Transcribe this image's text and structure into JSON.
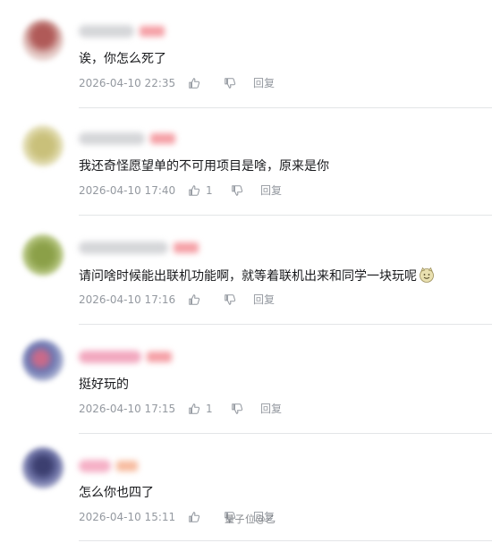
{
  "comments": [
    {
      "text": "诶，你怎么死了",
      "time": "2026-04-10 22:35",
      "likes": "",
      "reply": "回复",
      "avatar_color": "#d8b9b5",
      "name_color": "#d9d9dc",
      "level_color": "#f6a3a8"
    },
    {
      "text": "我还奇怪愿望单的不可用项目是啥，原来是你",
      "time": "2026-04-10 17:40",
      "likes": "1",
      "reply": "回复",
      "avatar_color": "#d6cf9e",
      "name_color": "#d9d9dc",
      "level_color": "#f6a3a8"
    },
    {
      "text": "请问啥时候能出联机功能啊，就等着联机出来和同学一块玩呢",
      "time": "2026-04-10 17:16",
      "likes": "",
      "reply": "回复",
      "avatar_color": "#a3b86a",
      "name_color": "#d9d9dc",
      "level_color": "#f6a3a8",
      "emoji": "smile-emoji"
    },
    {
      "text": "挺好玩的",
      "time": "2026-04-10 17:15",
      "likes": "1",
      "reply": "回复",
      "avatar_color": "#9aa0c4",
      "name_color": "#f3a7bd",
      "level_color": "#f6a3a8"
    },
    {
      "text": "怎么你也四了",
      "time": "2026-04-10 15:11",
      "likes": "",
      "reply": "回复",
      "avatar_color": "#7a7fb0",
      "name_color": "#f5b3c8",
      "level_color": "#f8c0a0"
    }
  ],
  "watermark": "量子位@乙"
}
